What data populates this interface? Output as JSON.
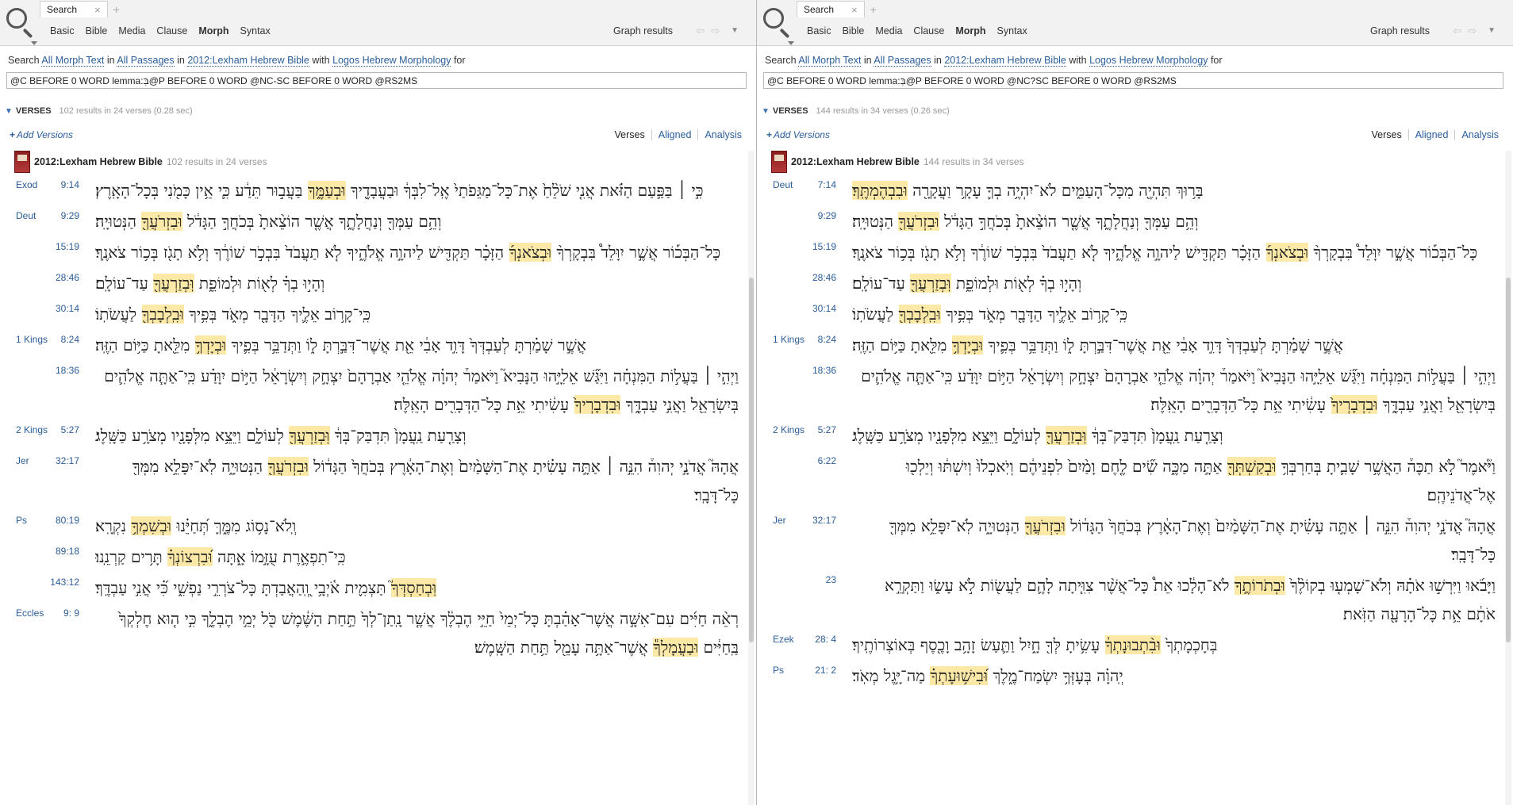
{
  "panes": [
    {
      "tab_label": "Search",
      "modes": [
        "Basic",
        "Bible",
        "Media",
        "Clause",
        "Morph",
        "Syntax"
      ],
      "active_mode": "Morph",
      "graph_results": "Graph results",
      "query_line": {
        "p1": "Search ",
        "l1": "All Morph Text",
        "p2": " in ",
        "l2": "All Passages",
        "p3": " in ",
        "l3": "2012:Lexham Hebrew Bible",
        "p4": " with ",
        "l4": "Logos Hebrew Morphology",
        "p5": " for"
      },
      "query": "@C BEFORE 0 WORD lemma:בְּ@P BEFORE 0 WORD @NC-SC BEFORE 0 WORD @RS2MS",
      "section": "VERSES",
      "section_meta": "102 results in 24 verses (0.28 sec)",
      "add_versions": "Add Versions",
      "view_links": [
        "Verses",
        "Aligned",
        "Analysis"
      ],
      "resource_name": "2012:Lexham Hebrew Bible",
      "resource_meta": "102 results in 24 verses",
      "verses": [
        {
          "book": "Exod",
          "cv": "9:14",
          "pre": "כִּ֣י ׀ בַּפַּ֣עַם הַזֹּ֗את אֲנִ֤י שֹׁלֵ֨חַ֙ אֶת־כָּל־מַגֵּפֹתַי֙ אֶֽל־לִבְּךָ֔ וּבַעֲבָדֶ֖יךָ ",
          "hl": "וּבְעַמֶּ֑ךָ",
          "post": " בַּעֲב֣וּר תֵּדַ֔ע כִּ֛י אֵ֥ין כָּמֹ֖נִי בְּכָל־הָאָֽרֶץ׃"
        },
        {
          "book": "Deut",
          "cv": "9:29",
          "pre": "וְהֵ֥ם עַמְּךָ֖ וְנַחֲלָתֶ֑ךָ אֲשֶׁ֤ר הוֹצֵ֨אתָ֙ בְּכֹחֲךָ֣ הַגָּדֹ֔ל ",
          "hl": "וּבִזְרֹעֲךָ֖",
          "post": " הַנְּטוּיָֽה׃"
        },
        {
          "book": "",
          "cv": "15:19",
          "pre": "כָּל־הַבְּכ֡וֹר אֲשֶׁ֣ר יִוָּלֵד֩ בִּבְקָרְךָ֨ ",
          "hl": "וּבְצֹאנְךָ֜",
          "post": " הַזָּכָ֗ר תַּקְדִּ֖ישׁ לַיהוָ֣ה אֱלֹהֶ֑יךָ לֹ֤א תַעֲבֹד֙ בִּבְכֹ֣ר שׁוֹרֶ֔ךָ וְלֹ֥א תָגֹ֖ז בְּכ֥וֹר צֹאנֶֽךָ׃"
        },
        {
          "book": "",
          "cv": "28:46",
          "pre": "וְהָי֣וּ בְךָ֗ לְא֖וֹת וּלְמוֹפֵ֑ת ",
          "hl": "וּֽבְזַרְעֲךָ֖",
          "post": " עַד־עוֹלָֽם׃"
        },
        {
          "book": "",
          "cv": "30:14",
          "pre": "כִּֽי־קָר֥וֹב אֵלֶ֛יךָ הַדָּבָ֖ר מְאֹ֑ד בְּפִ֥יךָ ",
          "hl": "וּבִֽלְבָבְךָ֖",
          "post": " לַעֲשֹׂתֽוֹ׃"
        },
        {
          "book": "1 Kings",
          "cv": "8:24",
          "pre": "אֲשֶׁ֣ר שָׁמַ֗רְתָּ לְעַבְדְּךָ֙ דָּוִ֣ד אָבִ֔י אֵ֖ת אֲשֶׁר־דִּבַּ֣רְתָּ ל֑וֹ וַתְּדַבֵּ֥ר בְּפִ֛יךָ ",
          "hl": "וּבְיָדְךָ֥",
          "post": " מִלֵּ֖אתָ כַּיּ֥וֹם הַזֶּֽה׃"
        },
        {
          "book": "",
          "cv": "18:36",
          "pre": "וַיְהִ֣י ׀ בַּעֲל֣וֹת הַמִּנְחָ֗ה וַיִּגַּ֞שׁ אֵלִיָּ֣הוּ הַנָּבִיא֮ וַיֹּאמַר֒ יְהוָ֗ה אֱלֹהֵ֤י אַבְרָהָם֙ יִצְחָ֣ק וְיִשְׂרָאֵ֔ל הַיּ֣וֹם יִוָּדַ֗ע כִּֽי־אַתָּ֧ה אֱלֹהִ֛ים בְּיִשְׂרָאֵ֖ל וַאֲנִ֣י עַבְדֶּ֑ךָ ",
          "hl": "וּבִדְבָרְיךָ֙",
          "post": " עָשִׂ֔יתִי אֵ֥ת כָּל־הַדְּבָרִ֖ים הָאֵֽלֶּה׃"
        },
        {
          "book": "2 Kings",
          "cv": "5:27",
          "pre": "וְצָרַ֤עַת נַֽעֲמָן֙ תִּדְבַּק־בְּךָ֔ ",
          "hl": "וּֽבְזַרְעֲךָ֖",
          "post": " לְעוֹלָ֑ם וַיֵּצֵ֥א מִלְּפָנָ֖יו מְצֹרָ֥ע כַּשָּֽׁלֶג׃"
        },
        {
          "book": "Jer",
          "cv": "32:17",
          "pre": "אֲהָהּ֮ אֲדֹנָ֣י יְהוִה֒ הִנֵּ֣ה ׀ אַתָּ֣ה עָשִׂ֗יתָ אֶת־הַשָּׁמַ֨יִם֙ וְאֶת־הָאָ֔רֶץ בְּכֹחֲךָ֙ הַגָּד֔וֹל ",
          "hl": "וּבִזְרֹעֲךָ֖",
          "post": " הַנְּטוּיָ֑ה לֹֽא־יִפָּלֵ֥א מִמְּךָ֖ כָּל־דָּבָֽר׃"
        },
        {
          "book": "Ps",
          "cv": "80:19",
          "pre": "וְֽלֹא־נָס֥וֹג מִמֶּ֑ךָּ תְּ֝חַיֵּ֗נוּ ",
          "hl": "וּבְשִׁמְךָ֥",
          "post": " נִקְרָֽא׃"
        },
        {
          "book": "",
          "cv": "89:18",
          "pre": "כִּֽי־תִפְאֶ֣רֶת עֻזָּ֣מוֹ אָ֑תָּה ",
          "hl": "וּ֝בִרְצוֹנְךָ֗",
          "post": " תָּר֥ים קַרְנֵֽנוּ׃"
        },
        {
          "book": "",
          "cv": "143:12",
          "pre": "",
          "hl": "וּֽבְחַסְדְּךָ֮",
          "post": " תַּצְמִ֪ית אֹ֫יְבָ֥י וְֽ֭הַאֲבַדְתָּ כָּל־צֹרְרֵ֣י נַפְשִׁ֑י כִּ֝֗י אֲנִ֣י עַבְדֶּֽךָ׃"
        },
        {
          "book": "Eccles",
          "cv": "9: 9",
          "pre": "רְאֵ֨ה חַיִּ֜ים עִם־אִשָּׁ֣ה אֲשֶׁר־אָהַ֗בְתָּ כָּל־יְמֵי֙ חַיֵּ֣י הֶבְלֶ֔ךָ אֲשֶׁ֤ר נָֽתַן־לְךָ֙ תַּ֣חַת הַשֶּׁ֔מֶשׁ כֹּ֖ל יְמֵ֣י הֶבְלֶ֑ךָ כִּ֣י ה֤וּא חֶלְקְךָ֙ בַּֽחַיִּ֔ים ",
          "hl": "וּבַעֲמָלְךָ֕",
          "post": " אֲשֶׁר־אַתָּ֥ה עָמֵ֖ל תַּ֥חַת הַשָּֽׁמֶשׁ׃"
        }
      ]
    },
    {
      "tab_label": "Search",
      "modes": [
        "Basic",
        "Bible",
        "Media",
        "Clause",
        "Morph",
        "Syntax"
      ],
      "active_mode": "Morph",
      "graph_results": "Graph results",
      "query_line": {
        "p1": "Search ",
        "l1": "All Morph Text",
        "p2": " in ",
        "l2": "All Passages",
        "p3": " in ",
        "l3": "2012:Lexham Hebrew Bible",
        "p4": " with ",
        "l4": "Logos Hebrew Morphology",
        "p5": " for"
      },
      "query": "@C BEFORE 0 WORD lemma:בְּ@P BEFORE 0 WORD @NC?SC BEFORE 0 WORD @RS2MS",
      "section": "VERSES",
      "section_meta": "144 results in 34 verses (0.26 sec)",
      "add_versions": "Add Versions",
      "view_links": [
        "Verses",
        "Aligned",
        "Analysis"
      ],
      "resource_name": "2012:Lexham Hebrew Bible",
      "resource_meta": "144 results in 34 verses",
      "verses": [
        {
          "book": "Deut",
          "cv": "7:14",
          "pre": "בָּר֥וּךְ תִּהְיֶ֖ה מִכָּל־הָעַמִּ֑ים לֹא־יִהְיֶ֥ה בְךָ֛ עָקָ֥ר וַעֲקָרָ֖ה ",
          "hl": "וּבִבְהֶמְתֶּֽךָ׃",
          "post": ""
        },
        {
          "book": "",
          "cv": "9:29",
          "pre": "וְהֵ֥ם עַמְּךָ֖ וְנַחֲלָתֶ֑ךָ אֲשֶׁ֤ר הוֹצֵ֨אתָ֙ בְּכֹחֲךָ֣ הַגָּדֹ֔ל ",
          "hl": "וּבִזְרֹעֲךָ֖",
          "post": " הַנְּטוּיָֽה׃"
        },
        {
          "book": "",
          "cv": "15:19",
          "pre": "כָּל־הַבְּכ֡וֹר אֲשֶׁ֣ר יִוָּלֵד֩ בִּבְקָרְךָ֨ ",
          "hl": "וּבְצֹאנְךָ֜",
          "post": " הַזָּכָ֗ר תַּקְדִּ֖ישׁ לַיהוָ֣ה אֱלֹהֶ֑יךָ לֹ֤א תַעֲבֹד֙ בִּבְכֹ֣ר שׁוֹרֶ֔ךָ וְלֹ֥א תָגֹ֖ז בְּכ֥וֹר צֹאנֶֽךָ׃"
        },
        {
          "book": "",
          "cv": "28:46",
          "pre": "וְהָי֣וּ בְךָ֗ לְא֖וֹת וּלְמוֹפֵ֑ת ",
          "hl": "וּֽבְזַרְעֲךָ֖",
          "post": " עַד־עוֹלָֽם׃"
        },
        {
          "book": "",
          "cv": "30:14",
          "pre": "כִּֽי־קָר֥וֹב אֵלֶ֛יךָ הַדָּבָ֖ר מְאֹ֑ד בְּפִ֥יךָ ",
          "hl": "וּבִֽלְבָבְךָ֖",
          "post": " לַעֲשֹׂתֽוֹ׃"
        },
        {
          "book": "1 Kings",
          "cv": "8:24",
          "pre": "אֲשֶׁ֣ר שָׁמַ֗רְתָּ לְעַבְדְּךָ֙ דָּוִ֣ד אָבִ֔י אֵ֖ת אֲשֶׁר־דִּבַּ֣רְתָּ ל֑וֹ וַתְּדַבֵּ֥ר בְּפִ֛יךָ ",
          "hl": "וּבְיָדְךָ֥",
          "post": " מִלֵּ֖אתָ כַּיּ֥וֹם הַזֶּֽה׃"
        },
        {
          "book": "",
          "cv": "18:36",
          "pre": "וַיְהִ֣י ׀ בַּעֲל֣וֹת הַמִּנְחָ֗ה וַיִּגַּ֞שׁ אֵלִיָּ֣הוּ הַנָּבִיא֮ וַיֹּאמַר֒ יְהוָ֗ה אֱלֹהֵ֤י אַבְרָהָם֙ יִצְחָ֣ק וְיִשְׂרָאֵ֔ל הַיּ֣וֹם יִוָּדַ֗ע כִּֽי־אַתָּ֧ה אֱלֹהִ֛ים בְּיִשְׂרָאֵ֖ל וַאֲנִ֣י עַבְדֶּ֑ךָ ",
          "hl": "וּבִדְבָרְיךָ֙",
          "post": " עָשִׂ֔יתִי אֵ֥ת כָּל־הַדְּבָרִ֖ים הָאֵֽלֶּה׃"
        },
        {
          "book": "2 Kings",
          "cv": "5:27",
          "pre": "וְצָרַ֤עַת נַֽעֲמָן֙ תִּדְבַּק־בְּךָ֔ ",
          "hl": "וּֽבְזַרְעֲךָ֖",
          "post": " לְעוֹלָ֑ם וַיֵּצֵ֥א מִלְּפָנָ֖יו מְצֹרָ֥ע כַּשָּֽׁלֶג׃"
        },
        {
          "book": "",
          "cv": "6:22",
          "pre": "וַיֹּ֘אמֶר֮ לֹ֣א תַכֶּה֒ הַאֲשֶׁ֥ר שָׁבִ֛יתָ בְּחַרְבְּךָ֥ ",
          "hl": "וּבְקַשְׁתְּךָ֖",
          "post": " אַתָּ֣ה מַכֶּ֑ה שִׂ֞ים לֶ֤חֶם וָמַ֨יִם֙ לִפְנֵיהֶ֔ם וְיֹֽאכְלוּ֙ וְיִשְׁתּ֔וּ וְיֵלְכ֖וּ אֶל־אֲדֹנֵיהֶֽם׃"
        },
        {
          "book": "Jer",
          "cv": "32:17",
          "pre": "אֲהָהּ֮ אֲדֹנָ֣י יְהוִה֒ הִנֵּ֣ה ׀ אַתָּ֣ה עָשִׂ֗יתָ אֶת־הַשָּׁמַ֨יִם֙ וְאֶת־הָאָ֔רֶץ בְּכֹחֲךָ֙ הַגָּד֔וֹל ",
          "hl": "וּבִזְרֹעֲךָ֖",
          "post": " הַנְּטוּיָ֑ה לֹֽא־יִפָּלֵ֥א מִמְּךָ֖ כָּל־דָּבָֽר׃"
        },
        {
          "book": "",
          "cv": "23",
          "pre": "וַיָּבֹ֜אוּ וַיִּרְשׁ֣וּ אֹתָ֗הּ וְלֹא־שָׁמְע֤וּ בְקוֹלֶ֨ךָ֙ ",
          "hl": "וּבְתֹרוֹתֶ֣ךָ",
          "post": " לֹא־הָלָ֔כוּ אֵת֩ כָּל־אֲשֶׁ֨ר צִוִּ֧יתָה לָהֶ֛ם לַעֲשׂ֖וֹת לֹ֣א עָשׂ֑וּ וַתַּקְרֵ֣א אֹתָ֔ם אֵ֥ת כָּל־הָרָעָ֖ה הַזֹּֽאת׃"
        },
        {
          "book": "Ezek",
          "cv": "28: 4",
          "pre": "בְּחָכְמָתְךָ֙ ",
          "hl": "וּבִ֨תְבוּנָתְךָ֔",
          "post": " עָשִׂ֥יתָ לְּךָ֖ חָ֑יִל וַתַּ֛עַשׂ זָהָ֥ב וָכֶ֖סֶף בְּאוֹצְרוֹתֶֽיךָ׃"
        },
        {
          "book": "Ps",
          "cv": "21: 2",
          "pre": "יְֽהוָ֗ה בְּעָזְּךָ֥ יִשְׂמַח־מֶ֑לֶךְ ",
          "hl": "וּ֝בִישׁ֥וּעָתְךָ֗",
          "post": " מַה־יָּ֥גֶל מְאֹֽד׃"
        }
      ]
    }
  ]
}
